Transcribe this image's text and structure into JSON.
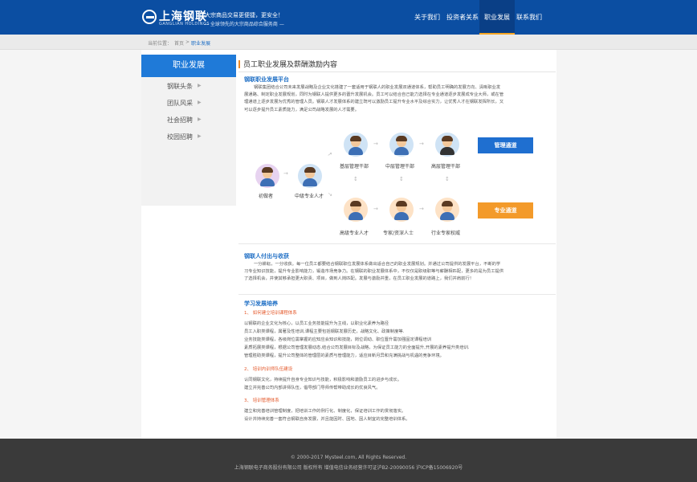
{
  "header": {
    "logo_text": "上海钢联",
    "logo_sub": "GANGLIAN HOLDINGS",
    "slogan_line1": "让大宗商品交易更便捷，更安全！",
    "slogan_line2": "— 全球领先的大宗商品综合服务商 —",
    "nav": [
      "关于我们",
      "投资者关系",
      "职业发展",
      "联系我们"
    ],
    "active_nav": "职业发展",
    "accent": "#f6a623",
    "bar_color": "#0b4ea2"
  },
  "breadcrumb": {
    "prefix": "当前位置：",
    "home": "首页",
    "sep": ">",
    "current": "职业发展"
  },
  "sidebar": {
    "title": "职业发展",
    "items": [
      "钢联头条",
      "团队风采",
      "社会招聘",
      "校园招聘"
    ]
  },
  "page_title": "员工职业发展及薪酬激励内容",
  "sections": {
    "platform": {
      "title": "钢联职业发展平台",
      "lines": [
        "钢联集团结合公司未来发展战略及企业文化搭建了一套适用于钢联人的职业发展双通道体系，帮助员工明确的发展方向、清晰职业发",
        "展通路、制定职业发展规划，同时为钢联人提供更多的晋升发展机会。员工可以结合自己能力选择在专业通道逐步发展成专业大师，或在管",
        "理通道上逐步发展为优秀的管理人员。钢联人才发展体系的建立既可以激励员工提升专业水平及综合实力，让优秀人才在钢联发挥所长，又",
        "可以逐步提升员工素质能力，满足公司战略发展的人才需要。"
      ]
    },
    "diagram": {
      "nodes": {
        "entry": "初做者",
        "mid": "中级专业人才",
        "grass_mgr": "基层管理干部",
        "mid_mgr": "中层管理干部",
        "senior_mgr": "高层管理干部",
        "senior_pro": "高级专业人才",
        "expert": "专家/资深人士",
        "authority": "行业专家权威"
      },
      "mgmt_channel": "管理通道",
      "pro_channel": "专业通道",
      "mgmt_color": "#1f6fd0",
      "pro_color": "#f39a2a"
    },
    "reward": {
      "title": "钢联人付出与收获",
      "lines": [
        "一分耕耘，一分收获。每一位员工都要结合钢联职位发展体系做出适合自己的职业发展规划。并通过公司提供的发展平台，不断的学",
        "习专业知识技能，提升专业影响能力，锻造市场竞争力。在钢联的职业发展体系中，不仅仅是职级职等与薪酬相匹配，更多的是为员工提供",
        "了选择机会，并使其够承担更大职责、项目，做到人岗匹配。发展与激励并重，在员工职业发展的道路上，我们并肩前行！"
      ]
    },
    "training": {
      "title": "学习发展培养",
      "sub1": "1、 如何建立培训课程体系",
      "sub1_lines": [
        "以钢联的企业文化为核心，以员工业务技能提升为主线，以职业化素养为路径",
        "员工入职类课程，属著及性培训,课程主要包括钢联发展历史，战略文化、政策制度等.",
        "业务技能类课程，各级岗位需掌握的应知应会知识和技能，岗位调动、职位晋升需加强固定课程培训",
        "素质拓展类课程，根据公司管理发展动态,结合公司发展目标及战略，为保证员工能力的全面提升,开展的素养提升类培训.",
        "管理胜助类课程，提升公司整体的管理层的素质与管理能力，适应目新月异和充满挑战与机遇的竞争环境。"
      ],
      "sub2": "2、 培训内训师队伍建设",
      "sub2_lines": [
        "认同钢联文化，持续提升自身专业知识与技能，积极影响和激励员工的进步与成长。",
        "建立并完善公司内部讲师队伍，倡导部门导师传帮带助成长的优良风气。"
      ],
      "sub3": "3、 培训管理体系",
      "sub3_lines": [
        "建立和完善培训管理制度，把培训工作的例行化、制度化，保证培训工作的贯彻落实。",
        "设计并持续完善一套符合钢联自身发展，并且能因时、因地、因人制宜的完整培训体系。"
      ]
    }
  },
  "footer": {
    "line1": "© 2000-2017 Mysteel.com, All Rights Reserved.",
    "line2": "上海钢联电子商务股份有限公司 版权所有 增值电信业务经营许可证沪B2-20090056   沪ICP备15006920号"
  }
}
